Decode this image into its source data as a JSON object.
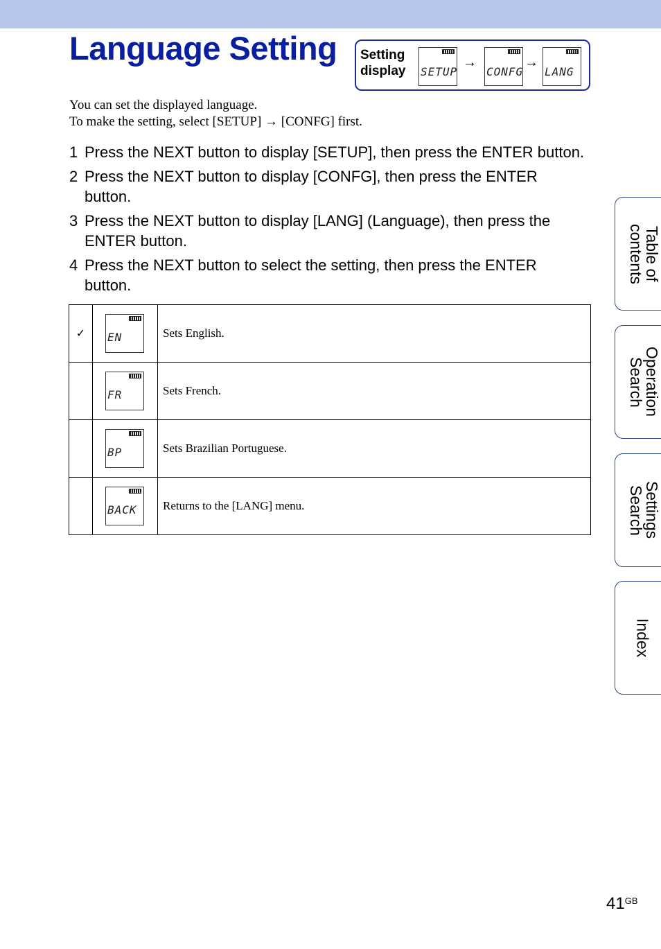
{
  "title": "Language Setting",
  "setting_display": {
    "label": "Setting display",
    "screens": [
      "SETUP",
      "CONFG",
      "LANG"
    ],
    "arrow": "→"
  },
  "intro": {
    "line1": "You can set the displayed language.",
    "line2": "To make the setting, select [SETUP] → [CONFG] first."
  },
  "steps": [
    {
      "num": "1",
      "text": "Press the NEXT button to display [SETUP], then press the ENTER button."
    },
    {
      "num": "2",
      "text": "Press the NEXT button to display [CONFG], then press the ENTER button."
    },
    {
      "num": "3",
      "text": "Press the NEXT button to display [LANG] (Language), then press the ENTER button."
    },
    {
      "num": "4",
      "text": "Press the NEXT button to select the setting, then press the ENTER button."
    }
  ],
  "options": [
    {
      "selected": true,
      "check": "✓",
      "screen": "EN",
      "description": "Sets English."
    },
    {
      "selected": false,
      "check": "",
      "screen": "FR",
      "description": "Sets French."
    },
    {
      "selected": false,
      "check": "",
      "screen": "BP",
      "description": "Sets Brazilian Portuguese."
    },
    {
      "selected": false,
      "check": "",
      "screen": "BACK",
      "description": "Returns to the [LANG] menu."
    }
  ],
  "side_tabs": [
    "Table of contents",
    "Operation Search",
    "Settings Search",
    "Index"
  ],
  "page": {
    "number": "41",
    "suffix": "GB"
  },
  "colors": {
    "header_bar": "#b6c6ec",
    "title": "#0a1ea0",
    "tab_border": "#2a4a8a"
  }
}
